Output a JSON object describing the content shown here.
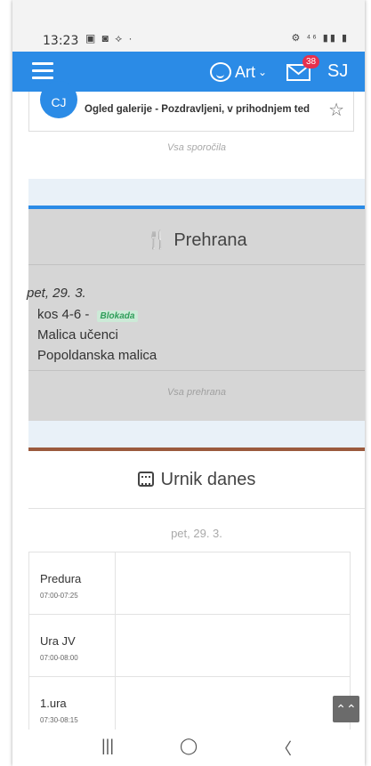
{
  "status_bar": {
    "time": "13:23",
    "left_icons": "▣ ◙ ⟡ ·",
    "right_icons": "⚙ ⁴⁶ ▮▮ ▮"
  },
  "app_bar": {
    "child_label": "Art",
    "mail_count": "38",
    "user_initials": "SJ"
  },
  "message": {
    "avatar": "CJ",
    "text": "Ogled galerije - Pozdravljeni, v prihodnjem ted"
  },
  "messages_link": "Vsa sporočila",
  "prehrana": {
    "title": "Prehrana",
    "date": "pet, 29. 3.",
    "items": [
      {
        "label": "kos 4-6 - ",
        "tag": "Blokada"
      },
      {
        "label": "Malica učenci"
      },
      {
        "label": "Popoldanska malica"
      }
    ],
    "link": "Vsa prehrana"
  },
  "urnik": {
    "title": "Urnik danes",
    "date": "pet, 29. 3.",
    "rows": [
      {
        "name": "Predura",
        "time": "07:00-07:25"
      },
      {
        "name": "Ura JV",
        "time": "07:00-08:00"
      },
      {
        "name": "1.ura",
        "time": "07:30-08:15"
      }
    ]
  },
  "nav": {
    "recent": "|||",
    "home": "◯",
    "back": "〈"
  },
  "scroll_top": "⌃⌃",
  "colors": {
    "primary": "#2b8be6",
    "badge": "#e8304d",
    "tag_bg": "#ccead7",
    "tag_text": "#2e9d59",
    "urnik_accent": "#9b5a3d"
  }
}
